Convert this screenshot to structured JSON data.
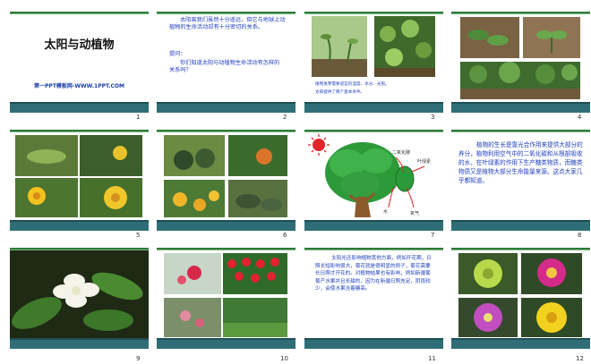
{
  "slides": [
    {
      "num": "1",
      "title": "太阳与动植物",
      "subtitle": "第一PPT模板网-WWW.1PPT.COM"
    },
    {
      "num": "2",
      "para1": "太阳离我们虽然十分遥远，但它与地球上动植物的生命活动却有十分密切的关系。",
      "question_label": "提问：",
      "question": "你们知道太阳与动植物生命活动有怎样的关系吗？"
    },
    {
      "num": "3",
      "caption1": "植物发芽需要适宜的温度、水分、光照。",
      "caption2": "太阳提供了两个基本条件。"
    },
    {
      "num": "4"
    },
    {
      "num": "5"
    },
    {
      "num": "6"
    },
    {
      "num": "7",
      "label_co2": "二氧化碳",
      "label_leaf": "叶绿素",
      "label_water": "水",
      "label_o2": "氧气"
    },
    {
      "num": "8",
      "text": "植物的生长是靠光合作用来提供大部分的养分，植物利用空气中的二氧化碳和从根部吸收的水，在叶绿素的作用下生产糖类物质，而糖类物质又是植物大部分生命能量来源。这点大家几乎都知道。"
    },
    {
      "num": "9"
    },
    {
      "num": "10"
    },
    {
      "num": "11",
      "text": "太阳光还影响植物其他方面，例如开花期，日照长短影响很大，菊花就是很明显的例子，菊花需要长日照才开花的。对植物结果也有影响，例如新疆葡萄产水果并且长甜的，因为在新疆日照充足，阴雨较少，会使水果含着糖高。"
    },
    {
      "num": "12"
    }
  ],
  "colors": {
    "footer": "#2f6e76",
    "topline": "#2f7a3a",
    "title_blue": "#1f3fbf"
  }
}
